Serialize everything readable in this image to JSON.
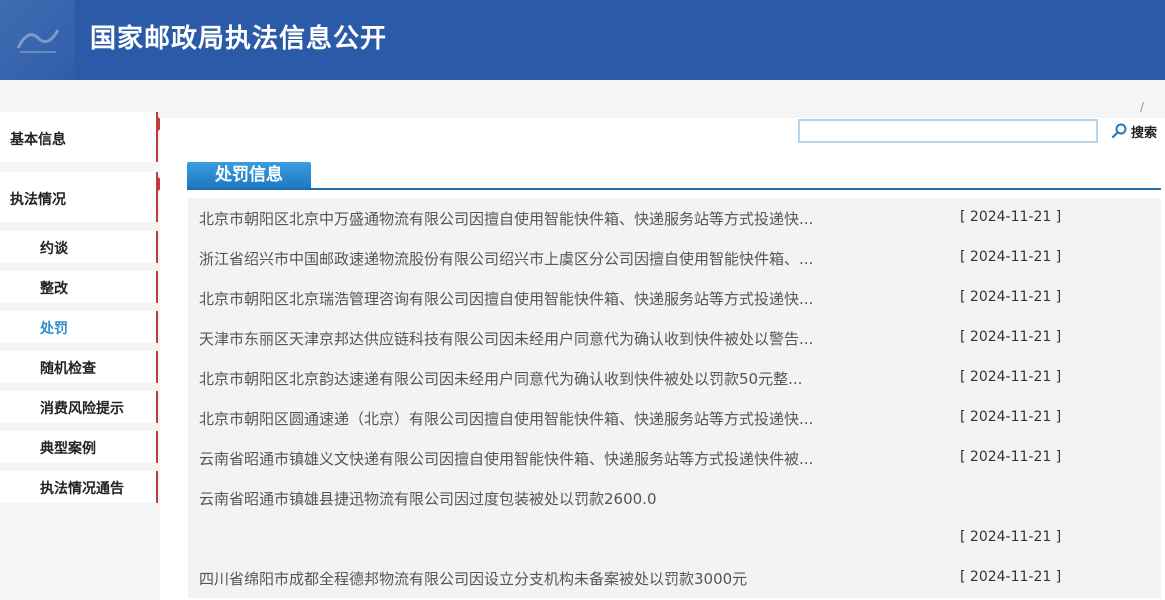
{
  "header": {
    "title": "国家邮政局执法信息公开"
  },
  "sidebar": {
    "sections": [
      {
        "label": "基本信息"
      },
      {
        "label": "执法情况"
      }
    ],
    "subitems": [
      {
        "label": "约谈",
        "active": false
      },
      {
        "label": "整改",
        "active": false
      },
      {
        "label": "处罚",
        "active": true
      },
      {
        "label": "随机检查",
        "active": false
      },
      {
        "label": "消费风险提示",
        "active": false
      },
      {
        "label": "典型案例",
        "active": false
      },
      {
        "label": "执法情况通告",
        "active": false
      }
    ]
  },
  "breadcrumb": {
    "separator": "/"
  },
  "search": {
    "value": "",
    "button_label": "搜索"
  },
  "tab": {
    "label": "处罚信息"
  },
  "items": [
    {
      "title": "北京市朝阳区北京中万盛通物流有限公司因擅自使用智能快件箱、快递服务站等方式投递快...",
      "date": "[ 2024-11-21 ]"
    },
    {
      "title": "浙江省绍兴市中国邮政速递物流股份有限公司绍兴市上虞区分公司因擅自使用智能快件箱、...",
      "date": "[ 2024-11-21 ]"
    },
    {
      "title": "北京市朝阳区北京瑞浩管理咨询有限公司因擅自使用智能快件箱、快递服务站等方式投递快...",
      "date": "[ 2024-11-21 ]"
    },
    {
      "title": "天津市东丽区天津京邦达供应链科技有限公司因未经用户同意代为确认收到快件被处以警告...",
      "date": "[ 2024-11-21 ]"
    },
    {
      "title": "北京市朝阳区北京韵达速递有限公司因未经用户同意代为确认收到快件被处以罚款50元整...",
      "date": "[ 2024-11-21 ]"
    },
    {
      "title": "北京市朝阳区圆通速递（北京）有限公司因擅自使用智能快件箱、快递服务站等方式投递快...",
      "date": "[ 2024-11-21 ]"
    },
    {
      "title": "云南省昭通市镇雄义文快递有限公司因擅自使用智能快件箱、快递服务站等方式投递快件被...",
      "date": "[ 2024-11-21 ]"
    },
    {
      "title": "云南省昭通市镇雄县捷迅物流有限公司因过度包装被处以罚款2600.0",
      "date": ""
    },
    {
      "title": "",
      "date": "[ 2024-11-21 ]"
    },
    {
      "title": "四川省绵阳市成都全程德邦物流有限公司因设立分支机构未备案被处以罚款3000元",
      "date": "[ 2024-11-21 ]"
    }
  ],
  "colors": {
    "header_bg": "#2b5ba8",
    "tab_bg": "#1e78c2",
    "accent_red": "#c23a3a",
    "active_link": "#2d8fc9"
  },
  "icons": {
    "search": "search-icon",
    "logo": "logo-icon"
  }
}
